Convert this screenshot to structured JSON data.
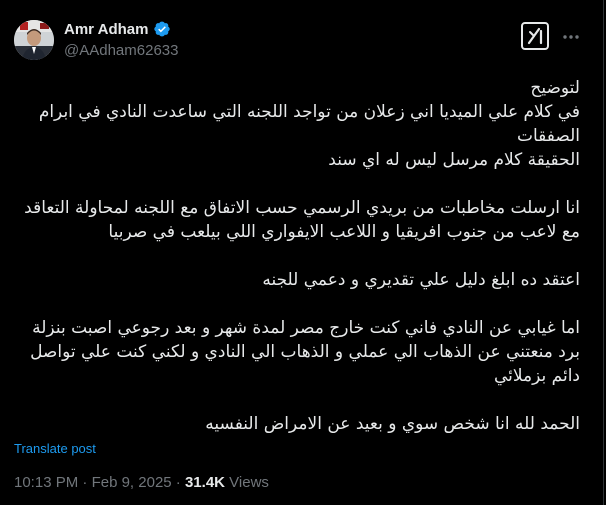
{
  "author": {
    "name": "Amr Adham",
    "handle": "@AAdham62633",
    "verified": true,
    "verified_color": "#1d9bf0"
  },
  "post": {
    "paragraphs": [
      [
        "لتوضيح",
        "في كلام علي الميديا اني زعلان من تواجد اللجنه التي ساعدت النادي في ابرام الصفقات",
        "الحقيقة كلام مرسل ليس له اي سند"
      ],
      [
        "انا ارسلت مخاطبات من بريدي الرسمي حسب الاتفاق مع اللجنه لمحاولة التعاقد مع لاعب من جنوب افريقيا و اللاعب الايفواري اللي بيلعب في صربيا"
      ],
      [
        "اعتقد ده ابلغ دليل علي تقديري و دعمي للجنه"
      ],
      [
        "اما غيابي عن النادي فاني كنت خارج مصر لمدة شهر و بعد رجوعي اصبت بنزلة برد منعتني عن الذهاب الي عملي و الذهاب الي النادي و لكني كنت علي تواصل دائم بزملائي"
      ],
      [
        "الحمد لله انا شخص سوي و بعيد عن الامراض النفسيه"
      ]
    ]
  },
  "translate_label": "Translate post",
  "meta": {
    "time": "10:13 PM",
    "separator": "·",
    "date": "Feb 9, 2025",
    "views_count": "31.4K",
    "views_label": "Views"
  },
  "icons": {
    "grok": "grok-icon",
    "more": "more-icon",
    "verified": "verified-badge-icon"
  },
  "colors": {
    "background": "#000000",
    "text": "#e7e9ea",
    "secondary": "#71767b",
    "accent": "#1d9bf0"
  }
}
